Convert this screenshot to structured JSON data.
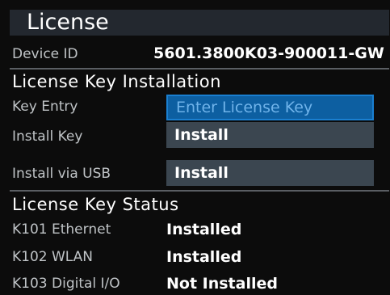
{
  "header": {
    "title": "License"
  },
  "device": {
    "label": "Device ID",
    "value": "5601.3800K03-900011-GW"
  },
  "installation": {
    "section_title": "License Key Installation",
    "key_entry": {
      "label": "Key Entry",
      "placeholder": "Enter License Key"
    },
    "install_key": {
      "label": "Install Key",
      "button_label": "Install"
    },
    "install_usb": {
      "label": "Install via USB",
      "button_label": "Install"
    }
  },
  "status": {
    "section_title": "License Key Status",
    "items": [
      {
        "label": "K101 Ethernet",
        "value": "Installed"
      },
      {
        "label": "K102 WLAN",
        "value": "Installed"
      },
      {
        "label": "K103 Digital I/O",
        "value": "Not Installed"
      }
    ]
  },
  "colors": {
    "background": "#0c0c0c",
    "title_bar": "#23282f",
    "field": "#3b4650",
    "active_field": "#0d5fa1",
    "placeholder_text": "#6fb3ea",
    "label_text": "#bfc3c6"
  }
}
